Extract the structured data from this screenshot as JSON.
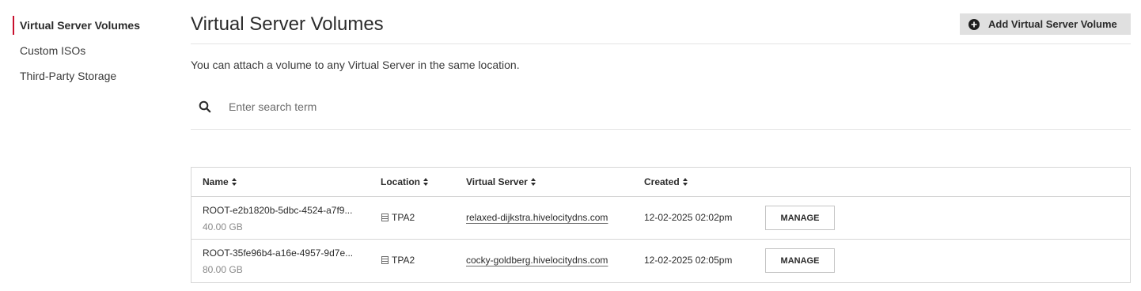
{
  "sidebar": {
    "items": [
      {
        "label": "Virtual Server Volumes",
        "active": true
      },
      {
        "label": "Custom ISOs",
        "active": false
      },
      {
        "label": "Third-Party Storage",
        "active": false
      }
    ]
  },
  "header": {
    "title": "Virtual Server Volumes",
    "add_button_label": "Add Virtual Server Volume",
    "add_button_icon": "plus-circle-icon"
  },
  "description": "You can attach a volume to any Virtual Server in the same location.",
  "search": {
    "placeholder": "Enter search term",
    "value": "",
    "icon": "search-icon"
  },
  "table": {
    "columns": [
      {
        "label": "Name",
        "sortable": true
      },
      {
        "label": "Location",
        "sortable": true
      },
      {
        "label": "Virtual Server",
        "sortable": true
      },
      {
        "label": "Created",
        "sortable": true
      }
    ],
    "rows": [
      {
        "name": "ROOT-e2b1820b-5dbc-4524-a7f9...",
        "size": "40.00 GB",
        "location": "TPA2",
        "virtual_server": "relaxed-dijkstra.hivelocitydns.com",
        "created": "12-02-2025 02:02pm",
        "action": "MANAGE"
      },
      {
        "name": "ROOT-35fe96b4-a16e-4957-9d7e...",
        "size": "80.00 GB",
        "location": "TPA2",
        "virtual_server": "cocky-goldberg.hivelocitydns.com",
        "created": "12-02-2025 02:05pm",
        "action": "MANAGE"
      }
    ]
  },
  "colors": {
    "accent": "#c8102e",
    "button_bg": "#e0e0e0"
  }
}
